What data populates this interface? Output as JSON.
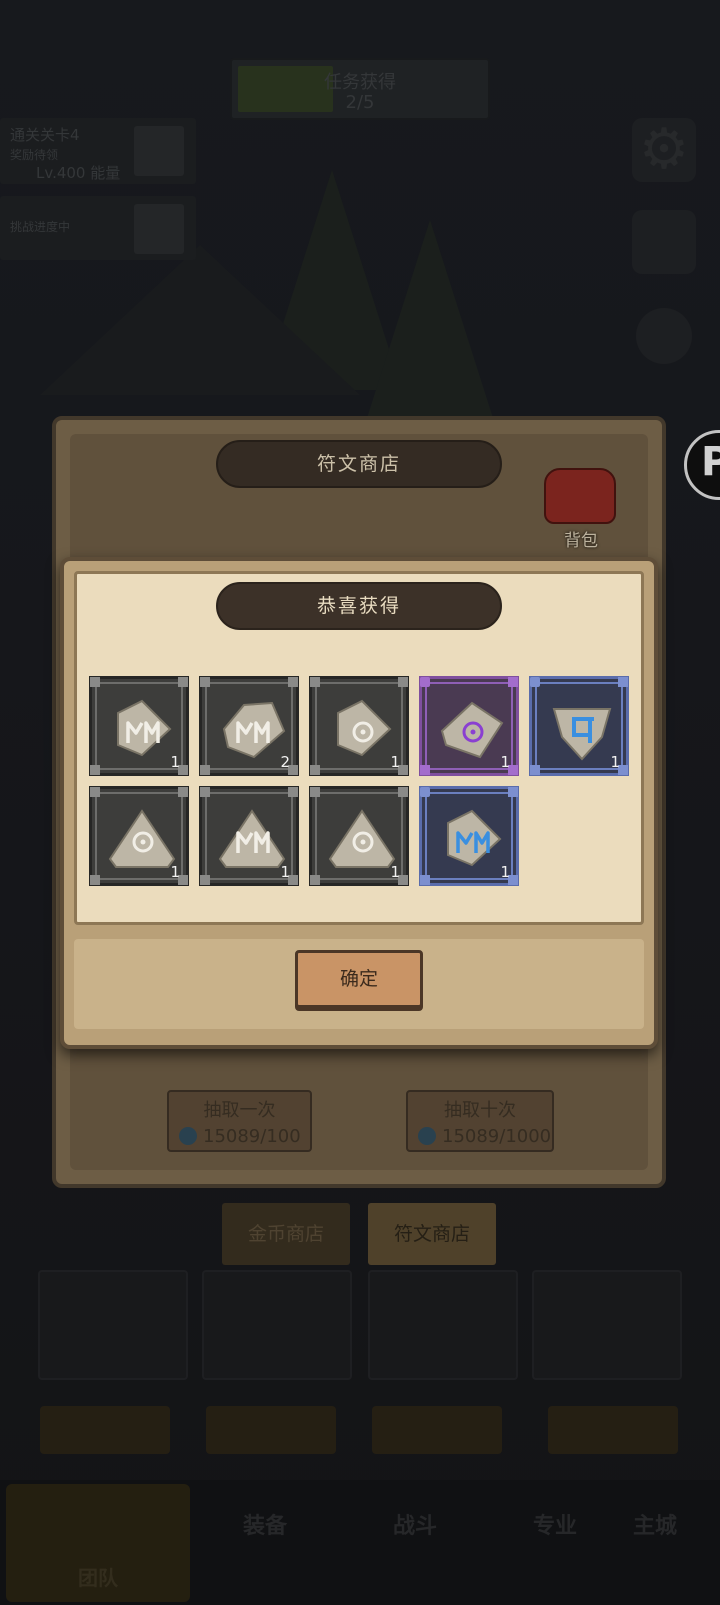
{
  "hud": {
    "quest_title": "任务获得",
    "quest_count": "2/5",
    "left_line1": "通关关卡4",
    "left_line2": "奖励待领",
    "left_level": "Lv.400 能量",
    "left_line3": "挑战进度中"
  },
  "shop": {
    "title": "符文商店",
    "bag_label": "背包",
    "draw_once_label": "抽取一次",
    "draw_once_cost": "15089/100",
    "draw_ten_label": "抽取十次",
    "draw_ten_cost": "15089/1000",
    "tab_gold": "金币商店",
    "tab_rune": "符文商店"
  },
  "result": {
    "title": "恭喜获得",
    "confirm_label": "确定",
    "items": [
      {
        "rarity": "common",
        "shape": "pentagon",
        "glyph": "PM",
        "qty": "1"
      },
      {
        "rarity": "common",
        "shape": "pentagon-wide",
        "glyph": "PM",
        "qty": "2"
      },
      {
        "rarity": "common",
        "shape": "pentagon",
        "glyph": "circle",
        "qty": "1"
      },
      {
        "rarity": "purple",
        "shape": "diamond",
        "glyph": "circle",
        "qty": "1"
      },
      {
        "rarity": "blue",
        "shape": "shield",
        "glyph": "bracket",
        "qty": "1"
      },
      {
        "rarity": "common",
        "shape": "triangle",
        "glyph": "circle",
        "qty": "1"
      },
      {
        "rarity": "common",
        "shape": "triangle",
        "glyph": "PM",
        "qty": "1"
      },
      {
        "rarity": "common",
        "shape": "triangle",
        "glyph": "circle",
        "qty": "1"
      },
      {
        "rarity": "blue",
        "shape": "pentagon",
        "glyph": "PM",
        "qty": "1"
      }
    ]
  },
  "bottom_nav": {
    "team": "团队",
    "equip": "装备",
    "battle": "战斗",
    "profession": "专业",
    "city": "主城"
  },
  "colors": {
    "rune_stone": "#bdb6a6",
    "glyph_common": "#f1eee6",
    "glyph_purple": "#8a3fd1",
    "glyph_blue": "#3a8fe0"
  }
}
